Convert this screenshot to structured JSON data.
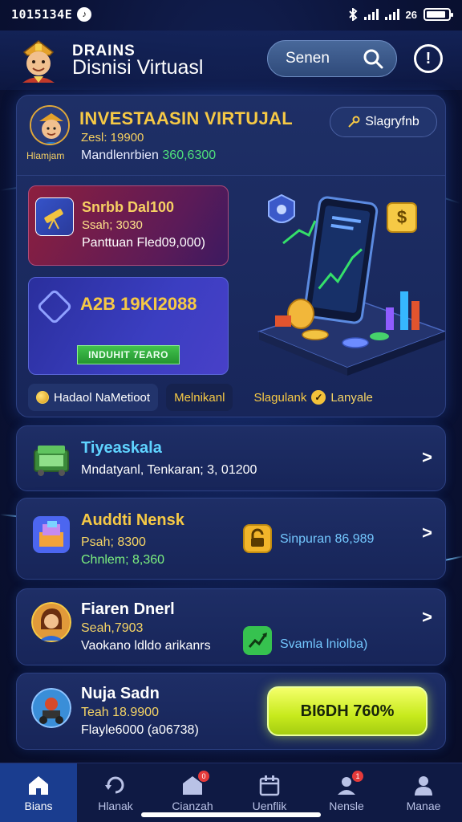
{
  "status_bar": {
    "time": "1015134E",
    "app_icon": "tiktok-icon",
    "battery_text": "26",
    "battery_level": 0.9
  },
  "header": {
    "brand_top": "DRAINS",
    "brand_bottom": "Disnisi Virtuasl",
    "search_label": "Senen",
    "search_icon": "search-icon",
    "info_icon": "info-icon"
  },
  "main_card": {
    "title": "INVESTAASIN VIRTUJAL",
    "subtitle1": "Zesl: 19900",
    "subtitle2_text": "Mandlenrbien",
    "subtitle2_value": "360,6300",
    "avatar_caption": "Hlamjam",
    "tag_button": "Slagryfnb",
    "tile_red": {
      "title": "Snrbb Dal100",
      "line1": "Ssah; 3030",
      "line2": "Panttuan Fled09,000)"
    },
    "tile_blue": {
      "title": "A2B 19KI2088",
      "badge": "INDUHIT 7EARO"
    },
    "footer": {
      "pill1": "Hadaol NaMetioot",
      "pill2": "Melnikanl",
      "plain1": "Slagulank",
      "plain2": "Lanyale"
    }
  },
  "list": [
    {
      "title": "Tiyeaskala",
      "line1": "Mndatyanl, Tenkaran; 3, 01200",
      "title_color": "#5fd3ff"
    },
    {
      "title": "Auddti Nensk",
      "line1": "Psah; 8300",
      "line2": "Chnlem; 8,360",
      "mid_text": "Sinpuran 86,989",
      "title_color": "#f6c945"
    },
    {
      "title": "Fiaren Dnerl",
      "line1": "Seah,7903",
      "line2": "Vaokano ldldo arikanrs",
      "mid_text": "Svamla lniolba)",
      "title_color": "#ffffff"
    },
    {
      "title": "Nuja Sadn",
      "line1": "Teah 18.9900",
      "line2": "Flayle6000 (a06738)",
      "cta": "BI6DH 760%",
      "title_color": "#ffffff"
    }
  ],
  "bottom_nav": [
    {
      "label": "Bians",
      "icon": "home-icon",
      "active": true
    },
    {
      "label": "Hlanak",
      "icon": "refresh-icon"
    },
    {
      "label": "Cianzah",
      "icon": "store-icon",
      "badge": "0"
    },
    {
      "label": "Uenflik",
      "icon": "calendar-icon"
    },
    {
      "label": "Nensle",
      "icon": "team-icon",
      "badge": "1"
    },
    {
      "label": "Manae",
      "icon": "profile-icon"
    }
  ]
}
